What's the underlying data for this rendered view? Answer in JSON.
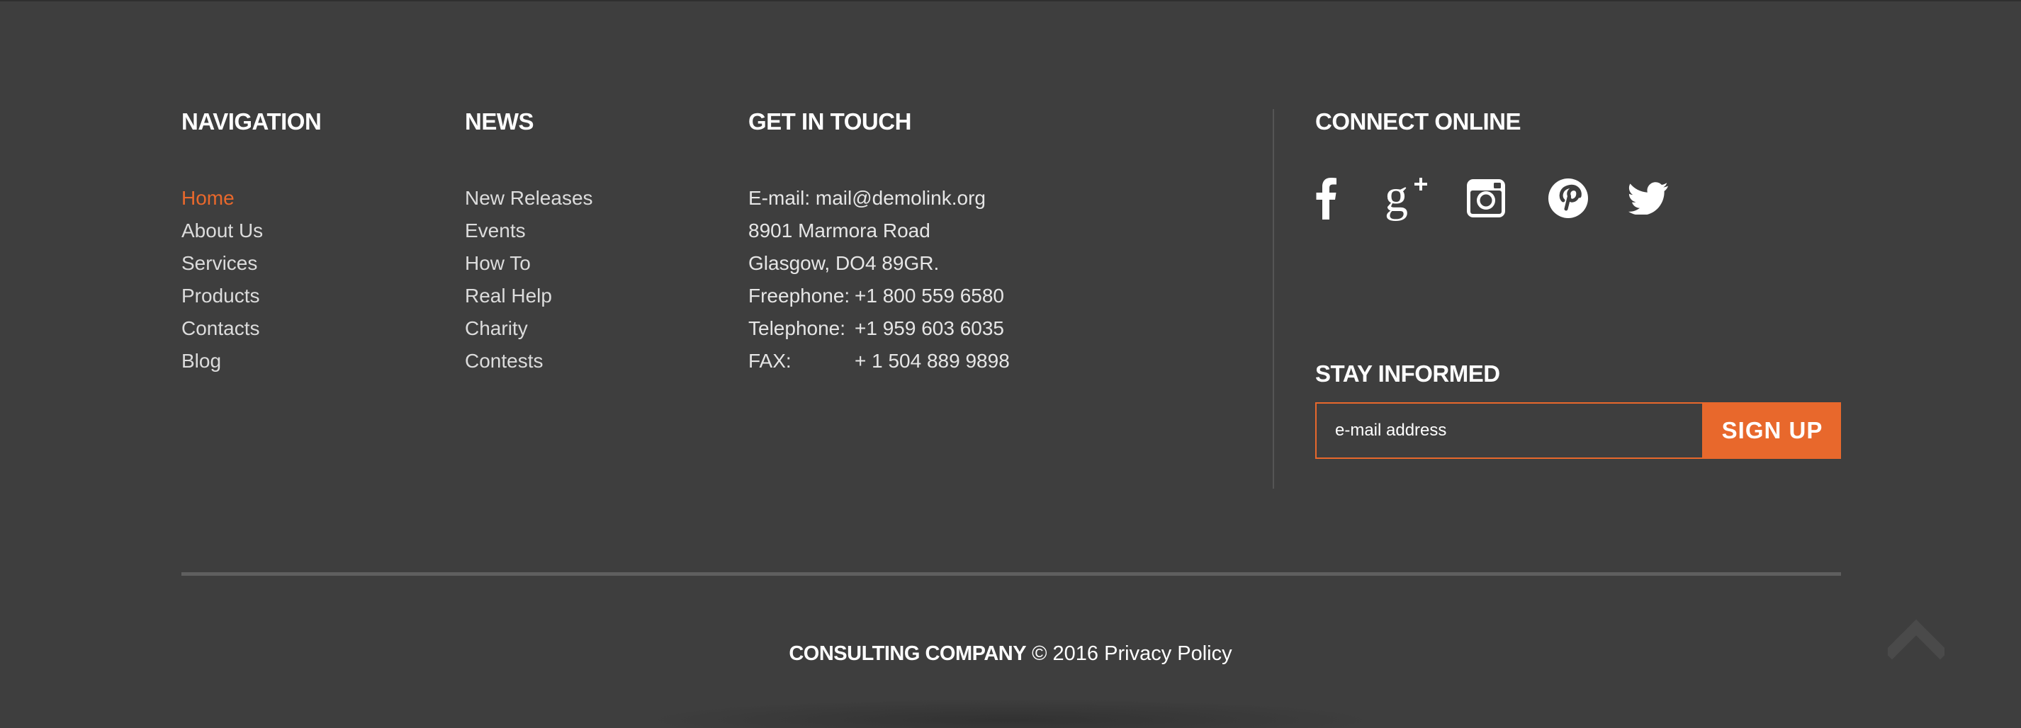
{
  "navigation": {
    "title": "NAVIGATION",
    "items": [
      {
        "label": "Home"
      },
      {
        "label": "About Us"
      },
      {
        "label": "Services"
      },
      {
        "label": "Products"
      },
      {
        "label": "Contacts"
      },
      {
        "label": "Blog"
      }
    ]
  },
  "news": {
    "title": "NEWS",
    "items": [
      {
        "label": "New Releases"
      },
      {
        "label": "Events"
      },
      {
        "label": "How To"
      },
      {
        "label": "Real Help"
      },
      {
        "label": "Charity"
      },
      {
        "label": "Contests"
      }
    ]
  },
  "contact": {
    "title": "GET IN TOUCH",
    "email_label": "E-mail:",
    "email_value": "mail@demolink.org",
    "address_line1": "8901 Marmora Road",
    "address_line2": "Glasgow, DO4 89GR.",
    "freephone_label": "Freephone:",
    "freephone_value": "+1 800 559 6580",
    "telephone_label": "Telephone:",
    "telephone_value": "+1 959 603 6035",
    "fax_label": "FAX:",
    "fax_value": "+ 1 504 889 9898"
  },
  "connect": {
    "title": "CONNECT ONLINE",
    "icons": [
      "facebook-icon",
      "google-plus-icon",
      "instagram-icon",
      "pinterest-icon",
      "twitter-icon"
    ]
  },
  "newsletter": {
    "title": "STAY INFORMED",
    "placeholder": "e-mail address",
    "button_label": "SIGN UP"
  },
  "copyright": {
    "company": "CONSULTING COMPANY",
    "year_text": "© 2016",
    "policy": "Privacy Policy"
  },
  "colors": {
    "background": "#3e3e3e",
    "accent": "#e8682c",
    "text": "#dcdcdc",
    "heading": "#ffffff"
  }
}
